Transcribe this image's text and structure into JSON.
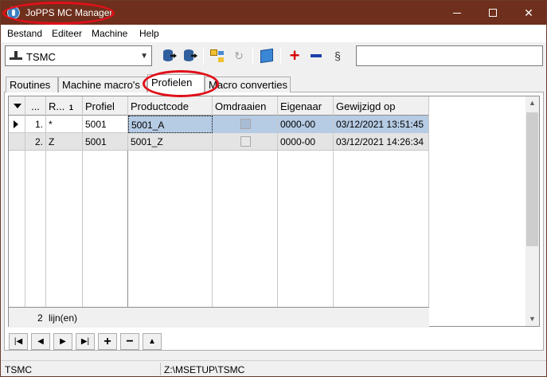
{
  "window": {
    "title": "JoPPS MC Manager"
  },
  "menu": [
    "Bestand",
    "Editeer",
    "Machine",
    "Help"
  ],
  "toolbar": {
    "machine_selected": "TSMC",
    "search_value": ""
  },
  "tabs": [
    {
      "label": "Routines",
      "active": false
    },
    {
      "label": "Machine macro's",
      "active": false
    },
    {
      "label": "Profielen",
      "active": true
    },
    {
      "label": "Macro converties",
      "active": false
    }
  ],
  "grid": {
    "columns": [
      "",
      "...",
      "R...",
      "Profiel",
      "Productcode",
      "Omdraaien",
      "Eigenaar",
      "Gewijzigd op"
    ],
    "sort_badge": "1",
    "rows": [
      {
        "nr": "1.",
        "r": "*",
        "profiel": "5001",
        "productcode": "5001_A",
        "omdraaien": false,
        "eigenaar": "0000-00",
        "gewijzigd": "03/12/2021 13:51:45",
        "current": true
      },
      {
        "nr": "2.",
        "r": "Z",
        "profiel": "5001",
        "productcode": "5001_Z",
        "omdraaien": false,
        "eigenaar": "0000-00",
        "gewijzigd": "03/12/2021 14:26:34",
        "current": false
      }
    ],
    "footer_count": "2",
    "footer_label": "lijn(en)"
  },
  "status": {
    "machine": "TSMC",
    "path": "Z:\\MSETUP\\TSMC"
  }
}
